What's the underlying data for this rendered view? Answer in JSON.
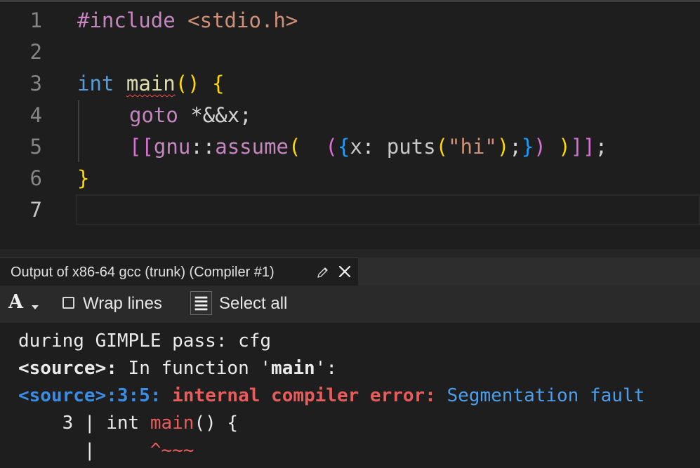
{
  "editor": {
    "line_numbers": [
      "1",
      "2",
      "3",
      "4",
      "5",
      "6",
      "7"
    ],
    "lines": {
      "l1": {
        "directive": "#include",
        "header": "<stdio.h>"
      },
      "l3": {
        "type": "int",
        "func": "main",
        "open_paren": "(",
        "close_paren": ")",
        "brace": "{"
      },
      "l4": {
        "keyword": "goto",
        "operand": "*&&x",
        "semicolon": ";"
      },
      "l5": {
        "attr_open": "[[",
        "ns": "gnu",
        "scope": "::",
        "attr": "assume",
        "paren_open": "(",
        "stmt_expr_open": "(",
        "block_open": "{",
        "label": "x",
        "colon": ":",
        "call": "puts",
        "call_open": "(",
        "string": "\"hi\"",
        "call_close": ")",
        "semi1": ";",
        "block_close": "}",
        "stmt_expr_close": ")",
        "paren_close": ")",
        "attr_close": "]]",
        "semi2": ";"
      },
      "l6": {
        "brace": "}"
      }
    }
  },
  "output_tab": {
    "title": "Output of x86-64 gcc (trunk) (Compiler #1)",
    "edit_icon": "pencil-icon",
    "close_icon": "close-icon"
  },
  "toolbar": {
    "font_icon_glyph": "A",
    "wrap_label": "Wrap lines",
    "wrap_checked": false,
    "select_all_label": "Select all"
  },
  "output": {
    "line1": "during GIMPLE pass: cfg",
    "line2": {
      "source": "<source>",
      "sep": ":",
      "text": " In function '",
      "fn": "main",
      "end": "':"
    },
    "line3": {
      "location": "<source>:3:5:",
      "kind": "internal compiler error:",
      "message": "Segmentation fault"
    },
    "line4": {
      "prefix": "    3 | int ",
      "fn": "main",
      "rest": "() {"
    },
    "line5": {
      "prefix": "      |     ",
      "marker": "^~~~"
    }
  },
  "colors": {
    "editor_bg": "#1e1e1e",
    "keyword": "#c586c0",
    "string": "#ce9178",
    "error_red": "#e85c5c",
    "link_blue": "#3a8de6"
  }
}
